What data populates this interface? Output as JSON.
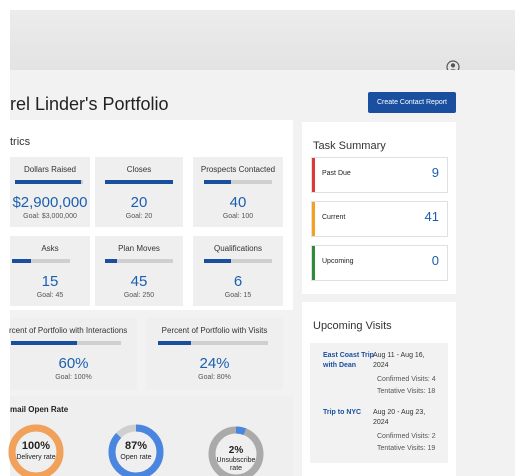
{
  "page": {
    "title": "rel Linder's Portfolio",
    "create_report_label": "Create Contact Report"
  },
  "metrics": {
    "section_title": "trics",
    "tiles": [
      {
        "label": "Dollars Raised",
        "value": "$2,900,000",
        "goal": "Goal: $3,000,000",
        "progress": 0.97
      },
      {
        "label": "Closes",
        "value": "20",
        "goal": "Goal: 20",
        "progress": 1.0
      },
      {
        "label": "Prospects Contacted",
        "value": "40",
        "goal": "Goal: 100",
        "progress": 0.4
      },
      {
        "label": "Asks",
        "value": "15",
        "goal": "Goal: 45",
        "progress": 0.33
      },
      {
        "label": "Plan Moves",
        "value": "45",
        "goal": "Goal: 250",
        "progress": 0.18
      },
      {
        "label": "Qualifications",
        "value": "6",
        "goal": "Goal: 15",
        "progress": 0.4
      }
    ],
    "wide_tiles": [
      {
        "label": "rcent of Portfolio with Interactions",
        "value": "60%",
        "goal": "Goal: 100%",
        "progress": 0.6
      },
      {
        "label": "Percent of Portfolio with Visits",
        "value": "24%",
        "goal": "Goal: 80%",
        "progress": 0.3
      }
    ]
  },
  "email": {
    "section_title": "mail Open Rate",
    "donuts": [
      {
        "value": "100%",
        "label": "Delivery rate",
        "fraction": 1.0,
        "color": "#f2a15a"
      },
      {
        "value": "87%",
        "label": "Open rate",
        "fraction": 0.87,
        "color": "#4a86e0"
      },
      {
        "value": "2%",
        "label_line1": "Unsubscribe",
        "label_line2": "rate",
        "fraction": 0.06,
        "color": "#4a86e0"
      }
    ]
  },
  "task_summary": {
    "title": "Task Summary",
    "rows": [
      {
        "label": "Past Due",
        "count": "9",
        "color": "#d93a3a"
      },
      {
        "label": "Current",
        "count": "41",
        "color": "#f2a121"
      },
      {
        "label": "Upcoming",
        "count": "0",
        "color": "#2f8a3c"
      }
    ]
  },
  "upcoming_visits": {
    "title": "Upcoming Visits",
    "visits": [
      {
        "name_line1": "East Coast Trip",
        "name_line2": "with Dean",
        "date_line1": "Aug 11 - Aug 16,",
        "date_line2": "2024",
        "confirmed": "Confirmed Visits: 4",
        "tentative": "Tentative Visits: 18"
      },
      {
        "name_line1": "Trip to NYC",
        "name_line2": "",
        "date_line1": "Aug 20 - Aug 23,",
        "date_line2": "2024",
        "confirmed": "Confirmed Visits: 2",
        "tentative": "Tentative Visits: 19"
      }
    ]
  },
  "colors": {
    "accent": "#1a4fa0",
    "value_blue": "#1b5fb0",
    "track_grey": "#cfcfcf"
  }
}
